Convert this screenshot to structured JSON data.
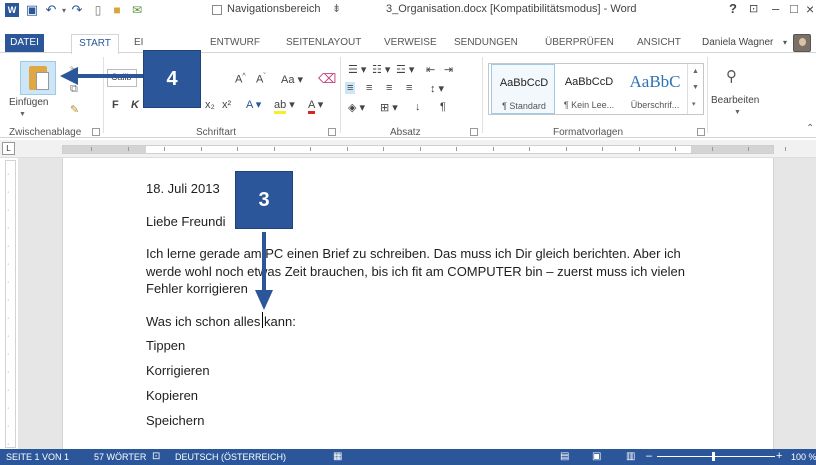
{
  "title_bar": {
    "nav_pane_label": "Navigationsbereich",
    "document_title": "3_Organisation.docx [Kompatibilitätsmodus] - Word",
    "help": "?",
    "minimize": "–",
    "restore": "□",
    "close": "×"
  },
  "tabs": {
    "file": "DATEI",
    "items": [
      "START",
      "EI",
      "ENTWURF",
      "SEITENLAYOUT",
      "VERWEISE",
      "SENDUNGEN",
      "ÜBERPRÜFEN",
      "ANSICHT"
    ],
    "user": "Daniela Wagner"
  },
  "ribbon": {
    "paste_label": "Einfügen",
    "font_name": "Calib",
    "groups": {
      "clipboard": "Zwischenablage",
      "font": "Schriftart",
      "paragraph": "Absatz",
      "styles": "Formatvorlagen"
    },
    "styles": [
      {
        "sample": "AaBbCcD",
        "name": "¶ Standard"
      },
      {
        "sample": "AaBbCcD",
        "name": "¶ Kein Lee..."
      },
      {
        "sample": "AaBbC",
        "name": "Überschrif..."
      }
    ],
    "edit_label": "Bearbeiten"
  },
  "document": {
    "lines": [
      "18. Juli 2013",
      "Liebe Freundi",
      "Ich lerne gerade am PC einen Brief zu schreiben. Das muss ich Dir gleich berichten. Aber ich",
      "werde wohl noch etwas Zeit brauchen, bis ich fit am COMPUTER bin – zuerst muss ich vielen",
      "Fehler korrigieren",
      "Was ich schon alles kann:",
      "Tippen",
      "Korrigieren",
      "Kopieren",
      "Speichern"
    ]
  },
  "callouts": {
    "paste": "4",
    "text": "3"
  },
  "status": {
    "page": "SEITE 1 VON 1",
    "words": "57 WÖRTER",
    "language": "DEUTSCH (ÖSTERREICH)",
    "zoom": "100 %"
  },
  "colors": {
    "accent": "#2b579a",
    "paste_highlight": "#cde6f7"
  }
}
